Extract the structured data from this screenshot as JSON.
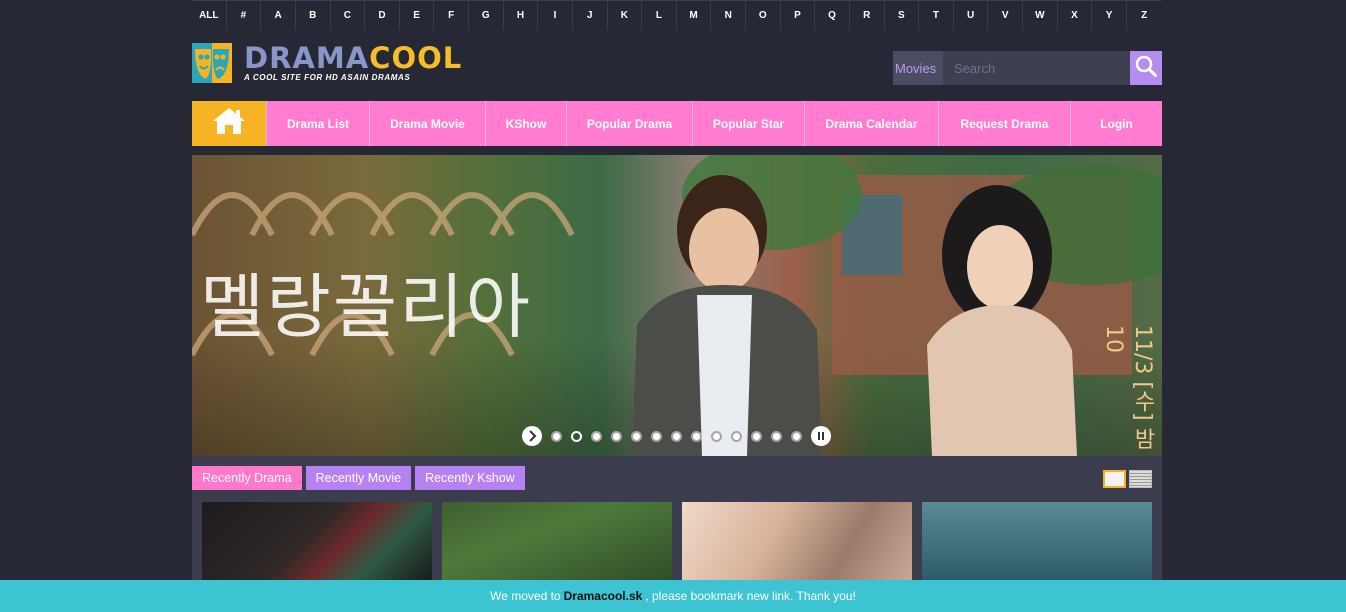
{
  "alphabet": [
    "ALL",
    "#",
    "A",
    "B",
    "C",
    "D",
    "E",
    "F",
    "G",
    "H",
    "I",
    "J",
    "K",
    "L",
    "M",
    "N",
    "O",
    "P",
    "Q",
    "R",
    "S",
    "T",
    "U",
    "V",
    "W",
    "X",
    "Y",
    "Z"
  ],
  "logo": {
    "word_part1": "DRAMA",
    "word_part2": "COOL",
    "tagline": "A COOL SITE FOR HD ASAIN DRAMAS"
  },
  "search": {
    "type_label": "Movies",
    "placeholder": "Search"
  },
  "nav": {
    "items": [
      "Drama List",
      "Drama Movie",
      "KShow",
      "Popular Drama",
      "Popular Star",
      "Drama Calendar",
      "Request Drama",
      "Login"
    ]
  },
  "slider": {
    "title_korean": "멜랑꼴리아",
    "date_korean": "11/3 [수] 밤 10",
    "slide_count": 13,
    "active_slide": 1
  },
  "tabs": [
    "Recently Drama",
    "Recently Movie",
    "Recently Kshow"
  ],
  "notice": {
    "before": "We moved to",
    "site": "Dramacool.sk",
    "after": ", please bookmark new link. Thank you!"
  },
  "colors": {
    "background": "#272836",
    "nav_pink": "#ff7cd0",
    "home_yellow": "#f6b424",
    "search_purple": "#b58cf0",
    "tab_pink": "#ff78cb",
    "tab_purple": "#b682f2",
    "notice_teal": "#3cc4d3"
  }
}
